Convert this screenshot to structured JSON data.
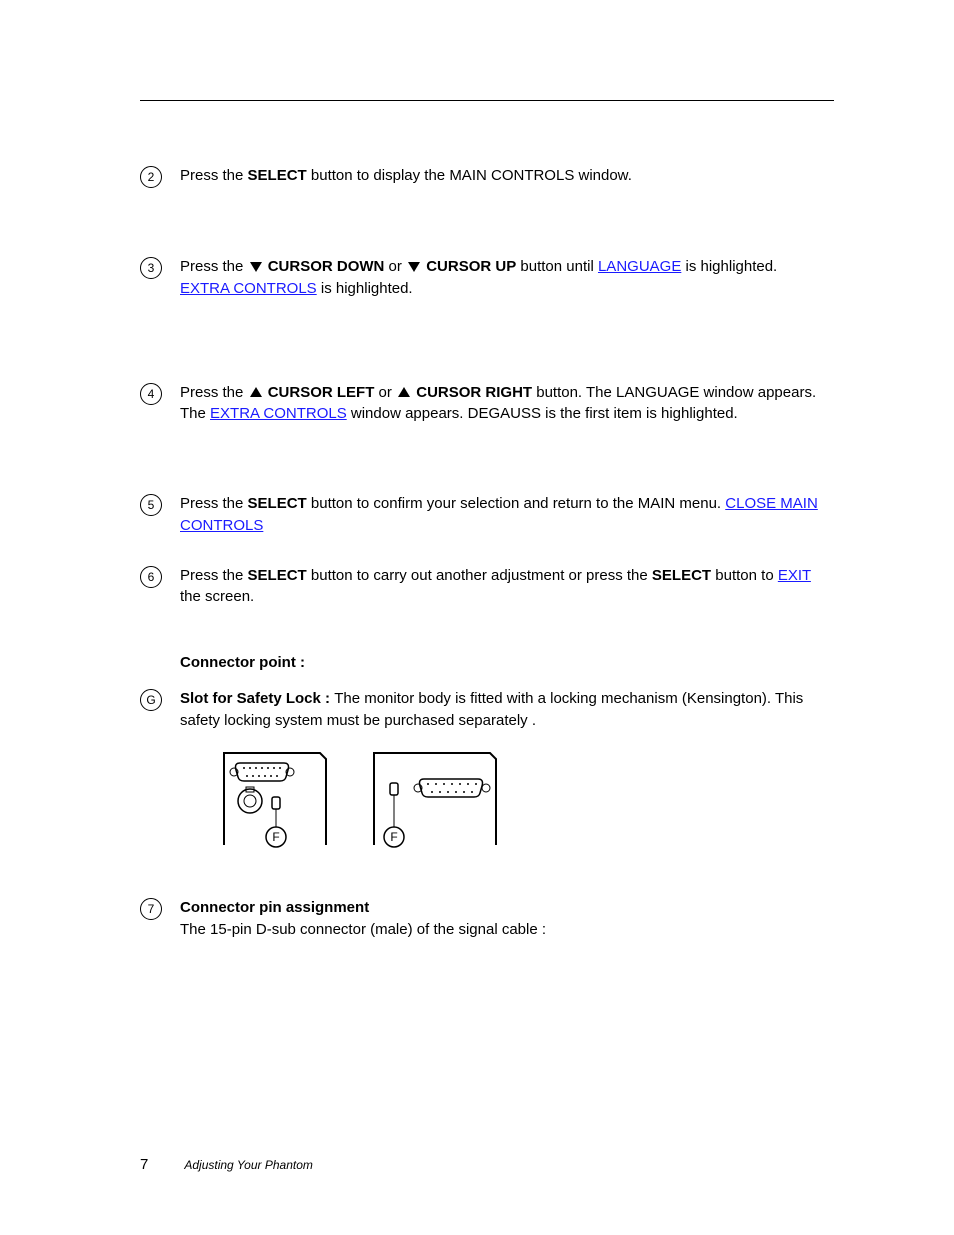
{
  "items": {
    "2": {
      "lead": "Press the ",
      "bold": "SELECT",
      "tail": " button to display the MAIN CONTROLS window."
    },
    "3": {
      "lead": "Press the ",
      "bold_a": " CURSOR DOWN",
      "mid": " or ",
      "bold_b": " CURSOR UP",
      "tail": " button until ",
      "link_pre": "",
      "link": "LANGUAGE",
      "post_link": " is highlighted.",
      "link2": "EXTRA CONTROLS",
      "post_link2": " is highlighted."
    },
    "4": {
      "lead": "Press the ",
      "bold_a": " CURSOR LEFT",
      "mid": " or ",
      "bold_b": " CURSOR RIGHT",
      "tail": " button. ",
      "link_pre": "The LANGUAGE window appears.",
      "link": "",
      "link2": "EXTRA CONTROLS",
      "post_link2": " window appears.",
      "post_text_line2_pre": "The ",
      "post_text_line2_post": " window appears. DEGAUSS is the first item is highlighted."
    },
    "5": {
      "lead": "Press the ",
      "bold": "SELECT",
      "tail": " button to confirm your selection and return to the MAIN menu.",
      "link": "CLOSE MAIN CONTROLS"
    },
    "6": {
      "pre": "Press the ",
      "bold_a_pre": "",
      "bold_a": "SELECT",
      "mid": " button to carry out another adjustment or press the ",
      "bold_b": " SELECT",
      "post": " button to ",
      "link": "EXIT",
      "post_link": " the screen."
    },
    "connector_point_title": "Connector point :",
    "7": {
      "lead": "Connector pin assignment ",
      "tail": "The 15-pin D-sub connector (male) of the signal cable :"
    },
    "g": {
      "lead": "Slot for Safety Lock : ",
      "tail": "The monitor body is fitted with a locking mechanism (Kensington). This safety locking system must be purchased separately ."
    }
  },
  "diagram_labels": {
    "f1": "F",
    "f2": "F"
  },
  "footer": {
    "page": "7",
    "text": "Adjusting Your Phantom"
  }
}
